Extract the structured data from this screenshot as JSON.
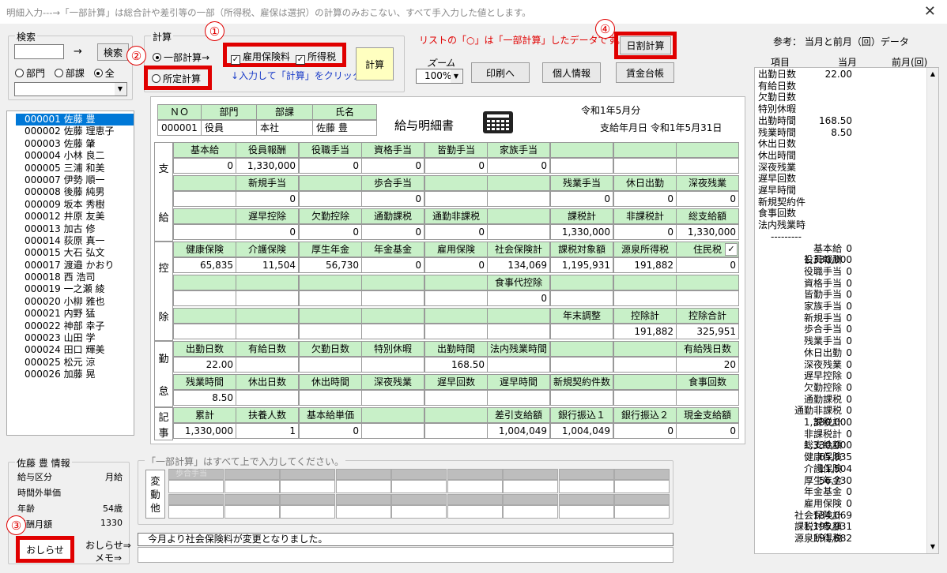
{
  "title": "明細入力---→「一部計算」は総合計や差引等の一部（所得税、雇保は選択）の計算のみおこない、すべて手入力した値とします。",
  "close_glyph": "✕",
  "search": {
    "label": "検索",
    "arrow": "→",
    "button": "検索",
    "radio_bumon": "部門",
    "radio_buka": "部課",
    "radio_all": "全",
    "dropdown_glyph": "▼"
  },
  "calc": {
    "label": "計算",
    "partial": "一部計算→",
    "koyo": "雇用保険料",
    "shotoku": "所得税",
    "fixed": "所定計算",
    "hint": "↓入力して「計算」をクリック ⇒",
    "calc_button": "計算",
    "checkmark": "✓"
  },
  "notice": "リストの「○」は「一部計算」したデータです。",
  "zoom": {
    "label": "ズーム",
    "value": "100%",
    "glyph": "▼"
  },
  "buttons": {
    "print": "印刷へ",
    "personal": "個人情報",
    "ledger": "賃金台帳",
    "daily": "日割計算",
    "oshirase": "おしらせ",
    "oshirase_link": "おしらせ⇒",
    "memo_link": "メモ⇒"
  },
  "badges": [
    "①",
    "②",
    "③",
    "④"
  ],
  "employees": [
    "000001 佐藤 豊",
    "000002 佐藤 理恵子",
    "000003 佐藤 肇",
    "000004 小林 良二",
    "000005 三浦 和美",
    "000007 伊勢 順一",
    "000008 後藤 純男",
    "000009 坂本 秀樹",
    "000012 井原 友美",
    "000013 加古 修",
    "000014 荻原 真一",
    "000015 大石 弘文",
    "000017 渡邉 かおり",
    "000018 西 浩司",
    "000019 一之瀬 綾",
    "000020 小柳 雅也",
    "000021 内野 猛",
    "000022 神部 幸子",
    "000023 山田 学",
    "000024 田口 輝美",
    "000025 松元 涼",
    "000026 加藤 晃"
  ],
  "info": {
    "title": "佐藤 豊 情報",
    "rows": [
      [
        "給与区分",
        "月給"
      ],
      [
        "時間外単価",
        ""
      ],
      [
        "年齢",
        "54歳"
      ],
      [
        "報酬月額",
        "1330"
      ]
    ]
  },
  "slip": {
    "header": {
      "no": "ＮＯ",
      "bumon": "部門",
      "buka": "部課",
      "name": "氏名"
    },
    "values": {
      "no": "000001",
      "bumon": "役員",
      "buka": "本社",
      "name": "佐藤 豊"
    },
    "title": "給与明細書",
    "period": "令和1年5月分",
    "paydate": "支給年月日 令和1年5月31日",
    "side": {
      "shikyu": [
        "支",
        "給"
      ],
      "kojo": [
        "控",
        "除"
      ],
      "kintai": [
        "勤",
        "怠"
      ],
      "kiji": [
        "記",
        "事"
      ]
    },
    "shikyu_rows": [
      {
        "h": [
          "基本給",
          "役員報酬",
          "役職手当",
          "資格手当",
          "皆勤手当",
          "家族手当",
          "",
          "",
          ""
        ],
        "v": [
          "0",
          "1,330,000",
          "0",
          "0",
          "0",
          "0",
          "",
          "",
          ""
        ]
      },
      {
        "h": [
          "",
          "新規手当",
          "",
          "歩合手当",
          "",
          "",
          "残業手当",
          "休日出勤",
          "深夜残業"
        ],
        "v": [
          "",
          "0",
          "",
          "0",
          "",
          "",
          "0",
          "0",
          "0"
        ]
      },
      {
        "h": [
          "",
          "遅早控除",
          "欠勤控除",
          "通勤課税",
          "通勤非課税",
          "",
          "課税計",
          "非課税計",
          "総支給額"
        ],
        "v": [
          "",
          "0",
          "0",
          "0",
          "0",
          "",
          "1,330,000",
          "0",
          "1,330,000"
        ]
      }
    ],
    "kojo_rows": [
      {
        "h": [
          "健康保険",
          "介護保険",
          "厚生年金",
          "年金基金",
          "雇用保険",
          "社会保険計",
          "課税対象額",
          "源泉所得税",
          "住民税"
        ],
        "v": [
          "65,835",
          "11,504",
          "56,730",
          "0",
          "0",
          "134,069",
          "1,195,931",
          "191,882",
          "0"
        ]
      },
      {
        "h": [
          "",
          "",
          "",
          "",
          "",
          "食事代控除",
          "",
          "",
          ""
        ],
        "v": [
          "",
          "",
          "",
          "",
          "",
          "0",
          "",
          "",
          ""
        ]
      },
      {
        "h": [
          "",
          "",
          "",
          "",
          "",
          "",
          "年末調整",
          "控除計",
          "控除合計"
        ],
        "v": [
          "",
          "",
          "",
          "",
          "",
          "",
          "",
          "191,882",
          "325,951"
        ]
      }
    ],
    "kintai_rows": [
      {
        "h": [
          "出勤日数",
          "有給日数",
          "欠勤日数",
          "特別休暇",
          "出勤時間",
          "法内残業時間",
          "",
          "",
          "有給残日数"
        ],
        "v": [
          "22.00",
          "",
          "",
          "",
          "168.50",
          "",
          "",
          "",
          "20"
        ]
      },
      {
        "h": [
          "残業時間",
          "休出日数",
          "休出時間",
          "深夜残業",
          "遅早回数",
          "遅早時間",
          "新規契約件数",
          "",
          "食事回数"
        ],
        "v": [
          "8.50",
          "",
          "",
          "",
          "",
          "",
          "",
          "",
          ""
        ]
      }
    ],
    "kiji_rows": [
      {
        "h": [
          "累計",
          "扶養人数",
          "基本給単価",
          "",
          "",
          "差引支給額",
          "銀行振込１",
          "銀行振込２",
          "現金支給額"
        ],
        "v": [
          "1,330,000",
          "1",
          "0",
          "",
          "",
          "1,004,049",
          "1,004,049",
          "0",
          "0"
        ]
      }
    ]
  },
  "partial": {
    "label": "「一部計算」はすべて上で入力してください。",
    "side": [
      "変",
      "動",
      "他"
    ],
    "first_cell": "歩合手当"
  },
  "message": "今月より社会保険料が変更となりました。",
  "right": {
    "title": "参考：  当月と前月（回）データ",
    "col_item": "項目",
    "col_cur": "当月",
    "col_prev": "前月(回)",
    "rows": [
      [
        "出勤日数",
        "22.00"
      ],
      [
        "有給日数",
        ""
      ],
      [
        "欠勤日数",
        ""
      ],
      [
        "特別休暇",
        ""
      ],
      [
        "出勤時間",
        "168.50"
      ],
      [
        "残業時間",
        "8.50"
      ],
      [
        "休出日数",
        ""
      ],
      [
        "休出時間",
        ""
      ],
      [
        "深夜残業",
        ""
      ],
      [
        "遅早回数",
        ""
      ],
      [
        "遅早時間",
        ""
      ],
      [
        "新規契約件",
        ""
      ],
      [
        "食事回数",
        ""
      ],
      [
        "法内残業時",
        ""
      ],
      [
        "---------",
        ""
      ],
      [
        "基本給",
        "0"
      ],
      [
        "役員報酬",
        "1,330,000"
      ],
      [
        "役職手当",
        "0"
      ],
      [
        "資格手当",
        "0"
      ],
      [
        "皆勤手当",
        "0"
      ],
      [
        "家族手当",
        "0"
      ],
      [
        "新規手当",
        "0"
      ],
      [
        "歩合手当",
        "0"
      ],
      [
        "残業手当",
        "0"
      ],
      [
        "休日出勤",
        "0"
      ],
      [
        "深夜残業",
        "0"
      ],
      [
        "遅早控除",
        "0"
      ],
      [
        "欠勤控除",
        "0"
      ],
      [
        "通勤課税",
        "0"
      ],
      [
        "通勤非課税",
        "0"
      ],
      [
        "課税計",
        "1,330,000"
      ],
      [
        "非課税計",
        "0"
      ],
      [
        "総支給額",
        "1,330,000"
      ],
      [
        "健康保険",
        "65,835"
      ],
      [
        "介護保険",
        "11,504"
      ],
      [
        "厚生年金",
        "56,730"
      ],
      [
        "年金基金",
        "0"
      ],
      [
        "雇用保険",
        "0"
      ],
      [
        "社会保険計",
        "134,069"
      ],
      [
        "課税対象額",
        "1,195,931"
      ],
      [
        "源泉所得税",
        "191,882"
      ]
    ],
    "scroll_up": "▲",
    "scroll_down": "▼"
  }
}
